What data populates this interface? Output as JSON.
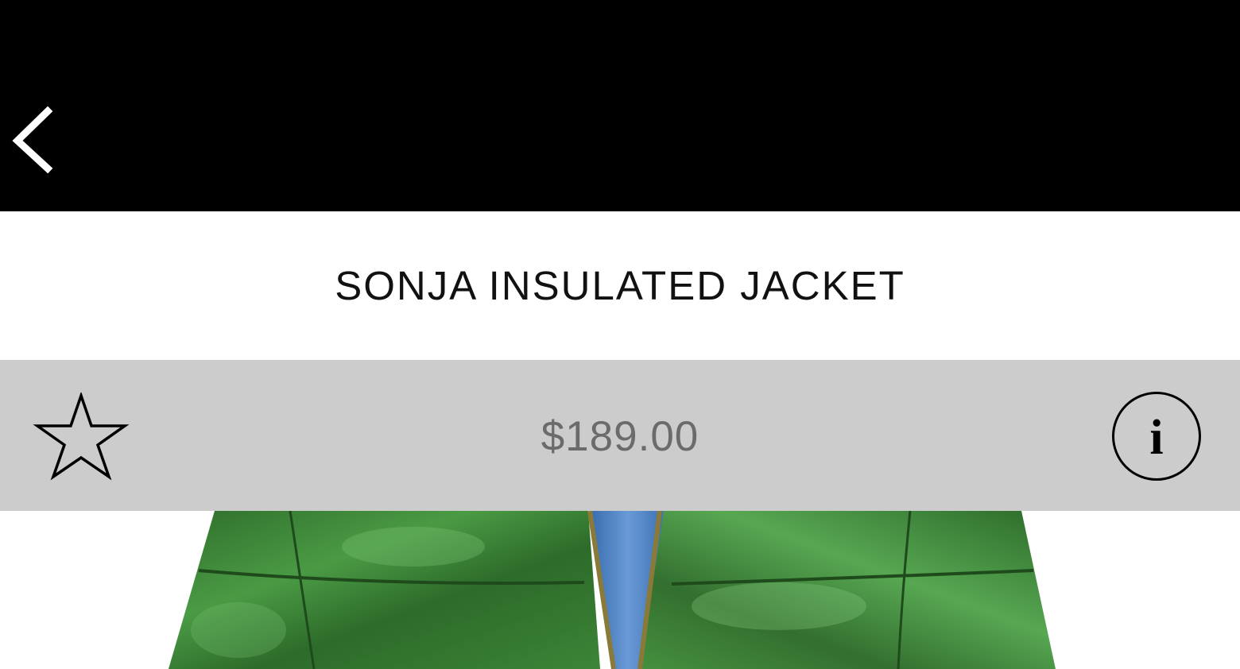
{
  "nav": {
    "back_icon": "chevron-left-icon"
  },
  "product": {
    "title": "SONJA INSULATED JACKET",
    "price": "$189.00",
    "favorite_icon": "star-outline-icon",
    "info_icon": "info-circle-icon",
    "info_glyph": "i",
    "image_description_colors": {
      "jacket": "#3f8a3a",
      "lining": "#4f86c9"
    }
  },
  "colors": {
    "navbar": "#000000",
    "price_band": "#cccccc",
    "price_text": "#6b6b6b",
    "title_text": "#111111"
  }
}
